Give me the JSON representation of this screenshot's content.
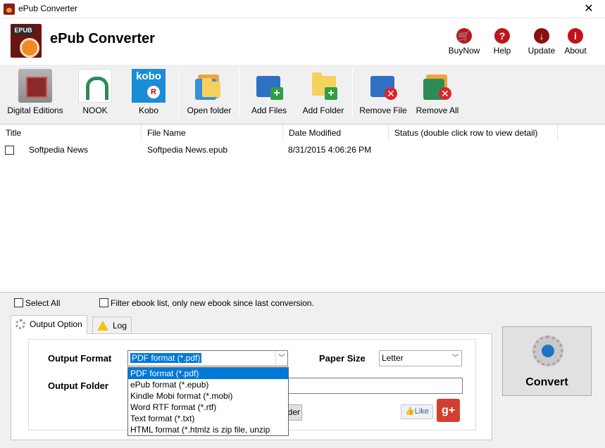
{
  "window": {
    "title": "ePub Converter",
    "close_glyph": "✕"
  },
  "header": {
    "app_name": "ePub Converter",
    "logo_tag": "EPUB",
    "buttons": [
      {
        "label": "BuyNow",
        "icon": "cart-icon",
        "glyph": "🛒"
      },
      {
        "label": "Help",
        "icon": "question-icon",
        "glyph": "?"
      },
      {
        "label": "Update",
        "icon": "download-arrow-icon",
        "glyph": "↓"
      },
      {
        "label": "About",
        "icon": "info-icon",
        "glyph": "i"
      }
    ]
  },
  "toolbar": {
    "items": [
      {
        "label": "Digital Editions",
        "icon": "digital-editions-icon"
      },
      {
        "label": "NOOK",
        "icon": "nook-icon"
      },
      {
        "label": "Kobo",
        "icon": "kobo-icon",
        "icon_text": "kobo",
        "badge_text": "R"
      },
      {
        "label": "Open folder",
        "icon": "open-folder-icon"
      },
      {
        "label": "Add Files",
        "icon": "add-files-icon"
      },
      {
        "label": "Add Folder",
        "icon": "add-folder-icon"
      },
      {
        "label": "Remove File",
        "icon": "remove-file-icon"
      },
      {
        "label": "Remove All",
        "icon": "remove-all-icon"
      }
    ],
    "plus_glyph": "+",
    "x_glyph": "✕"
  },
  "filelist": {
    "columns": [
      "Title",
      "File Name",
      "Date Modified",
      "Status (double click row to view detail)"
    ],
    "rows": [
      {
        "checked": false,
        "title": "Softpedia News",
        "file_name": "Softpedia News.epub",
        "date_modified": "8/31/2015 4:06:26 PM",
        "status": ""
      }
    ]
  },
  "controls": {
    "select_all": "Select All",
    "filter": "Filter ebook list, only new ebook since last conversion."
  },
  "tabs": [
    {
      "label": "Output Option",
      "active": true,
      "icon": "gear-icon"
    },
    {
      "label": "Log",
      "active": false,
      "icon": "warning-icon"
    }
  ],
  "output": {
    "format_label": "Output Format",
    "format_value": "PDF format (*.pdf)",
    "paper_size_label": "Paper Size",
    "paper_size_value": "Letter",
    "folder_label": "Output Folder",
    "folder_value": "",
    "folder_button_partial": "der",
    "format_options": [
      "PDF format (*.pdf)",
      "ePub format (*.epub)",
      "Kindle Mobi format (*.mobi)",
      "Word RTF format (*.rtf)",
      "Text format (*.txt)",
      "HTML format (*.htmlz is zip file, unzip"
    ],
    "selected_option_index": 0
  },
  "social": {
    "like_label": "Like",
    "gplus_label": "g+"
  },
  "convert": {
    "label": "Convert"
  },
  "colors": {
    "accent": "#0078d7",
    "brand_red": "#c0141b",
    "window_bg": "#f0f0f0"
  }
}
